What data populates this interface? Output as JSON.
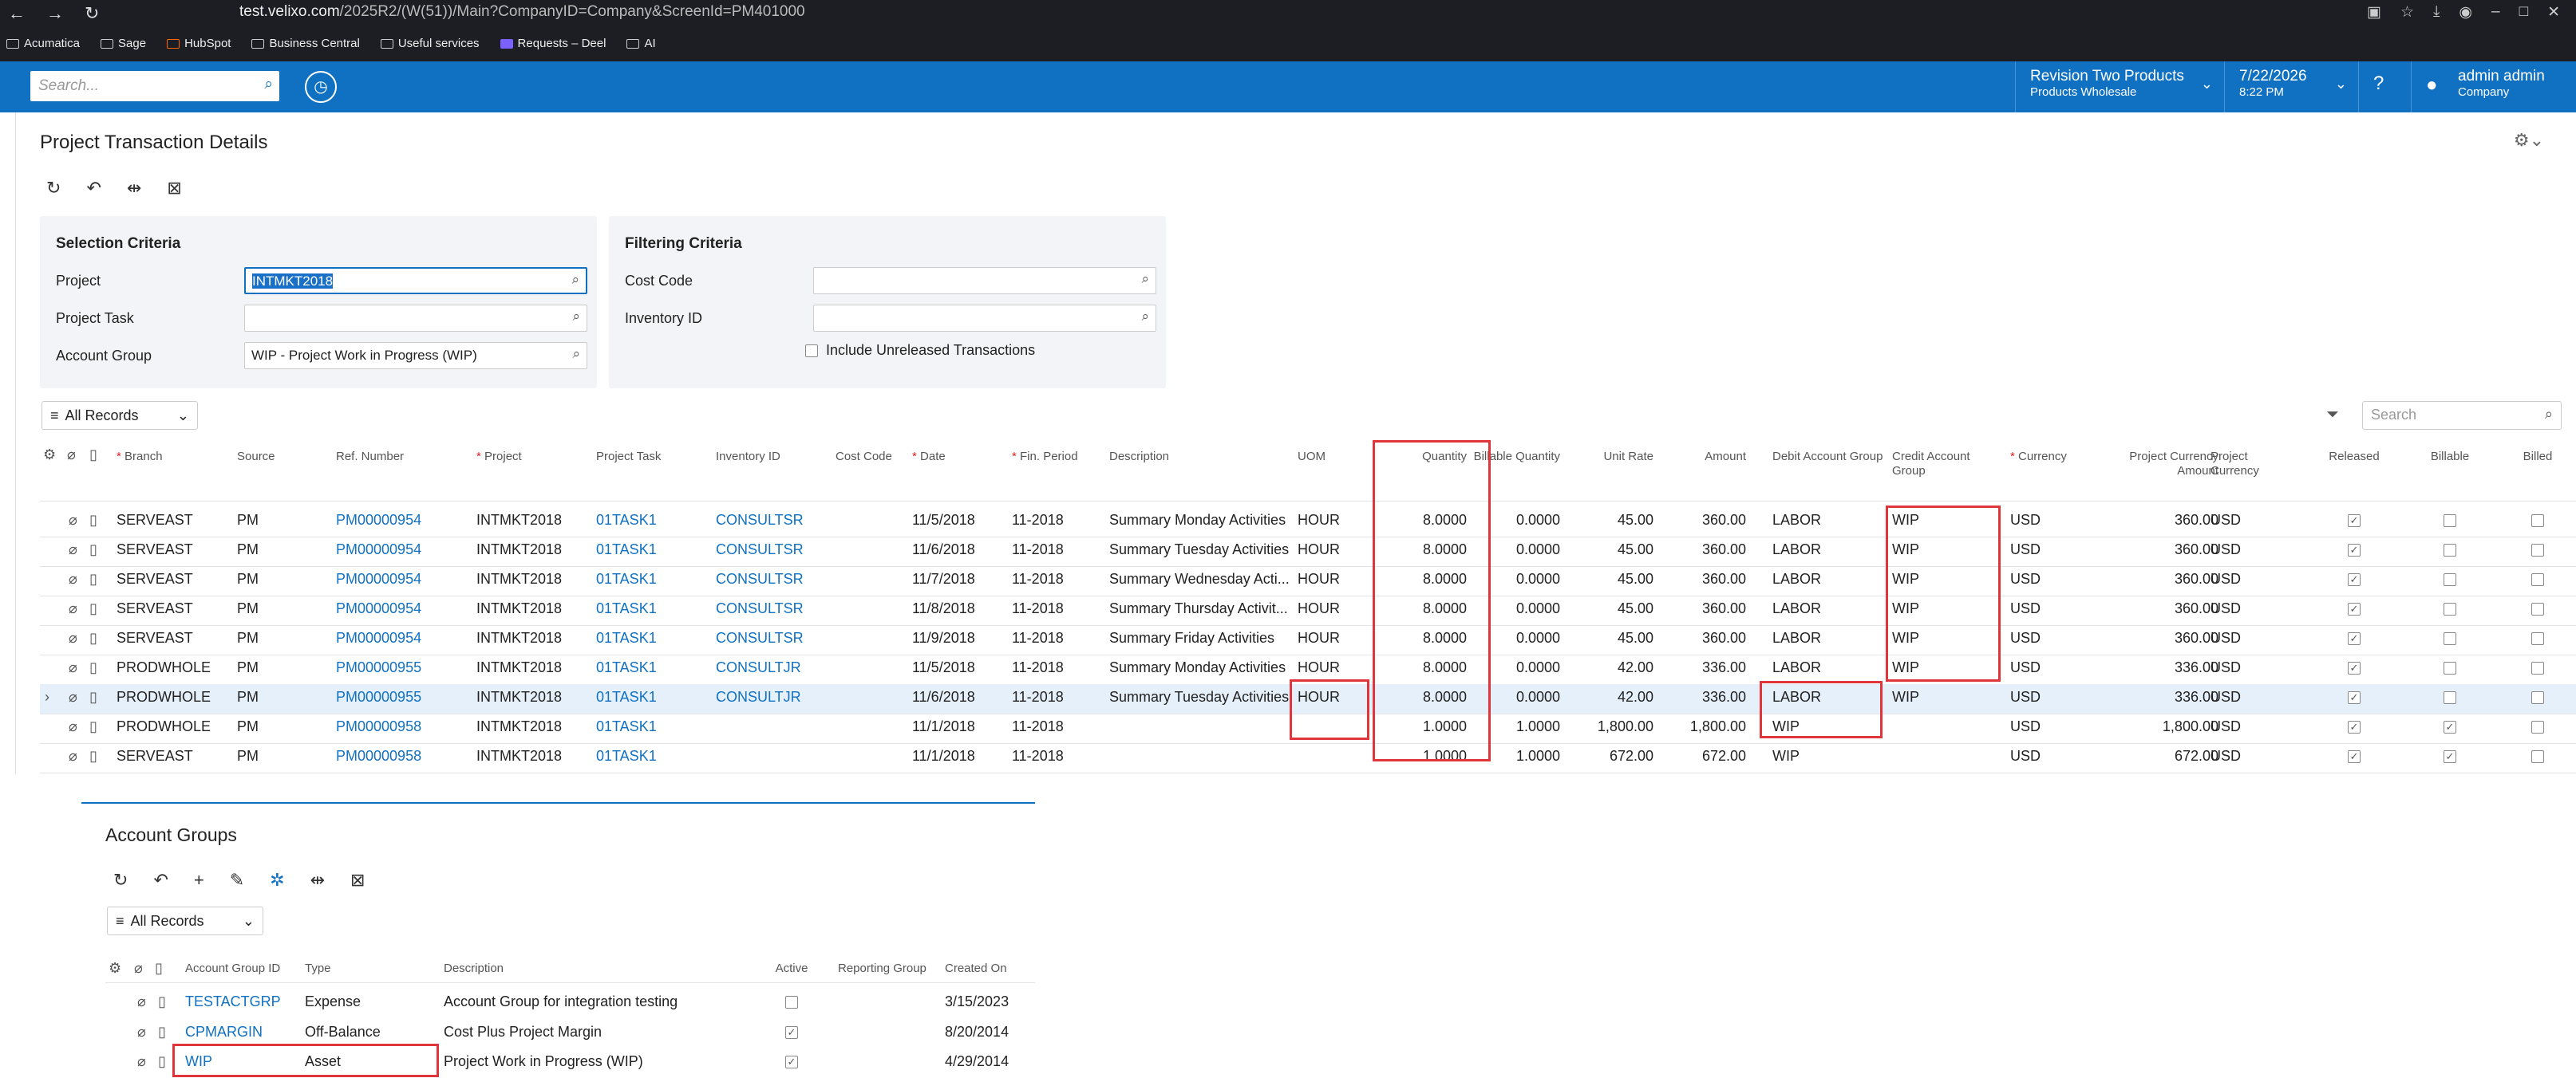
{
  "browser": {
    "url_host": "test.velixo.com",
    "url_path": "/2025R2/(W(51))/Main?CompanyID=Company&ScreenId=PM401000",
    "bookmarks": [
      "Acumatica",
      "Sage",
      "HubSpot",
      "Business Central",
      "Useful services",
      "Requests – Deel",
      "AI"
    ]
  },
  "topbar": {
    "search_placeholder": "Search...",
    "company": "Revision Two Products",
    "branch": "Products Wholesale",
    "date": "7/22/2026",
    "time": "8:22 PM",
    "user": "admin admin",
    "user_company": "Company"
  },
  "page": {
    "title": "Project Transaction Details"
  },
  "selection": {
    "title": "Selection Criteria",
    "project_label": "Project",
    "project_value": "INTMKT2018",
    "task_label": "Project Task",
    "task_value": "",
    "acctgrp_label": "Account Group",
    "acctgrp_value": "WIP - Project Work in Progress (WIP)"
  },
  "filtering": {
    "title": "Filtering Criteria",
    "costcode_label": "Cost Code",
    "inventory_label": "Inventory ID",
    "unreleased_label": "Include Unreleased Transactions"
  },
  "grid": {
    "view": "All Records",
    "search_placeholder": "Search",
    "columns": [
      "Branch",
      "Source",
      "Ref. Number",
      "Project",
      "Project Task",
      "Inventory ID",
      "Cost Code",
      "Date",
      "Fin. Period",
      "Description",
      "UOM",
      "Quantity",
      "Billable Quantity",
      "Unit Rate",
      "Amount",
      "Debit Account Group",
      "Credit Account Group",
      "Currency",
      "Project Currency Amount",
      "Project Currency",
      "Released",
      "Billable",
      "Billed"
    ],
    "rows": [
      {
        "branch": "SERVEAST",
        "source": "PM",
        "ref": "PM00000954",
        "project": "INTMKT2018",
        "task": "01TASK1",
        "inv": "CONSULTSR",
        "date": "11/5/2018",
        "period": "11-2018",
        "desc": "Summary Monday Activities",
        "uom": "HOUR",
        "qty": "8.0000",
        "bqty": "0.0000",
        "rate": "45.00",
        "amount": "360.00",
        "debit": "LABOR",
        "credit": "WIP",
        "cur": "USD",
        "pamt": "360.00",
        "pcur": "USD",
        "released": true,
        "billable": false
      },
      {
        "branch": "SERVEAST",
        "source": "PM",
        "ref": "PM00000954",
        "project": "INTMKT2018",
        "task": "01TASK1",
        "inv": "CONSULTSR",
        "date": "11/6/2018",
        "period": "11-2018",
        "desc": "Summary Tuesday Activities",
        "uom": "HOUR",
        "qty": "8.0000",
        "bqty": "0.0000",
        "rate": "45.00",
        "amount": "360.00",
        "debit": "LABOR",
        "credit": "WIP",
        "cur": "USD",
        "pamt": "360.00",
        "pcur": "USD",
        "released": true,
        "billable": false
      },
      {
        "branch": "SERVEAST",
        "source": "PM",
        "ref": "PM00000954",
        "project": "INTMKT2018",
        "task": "01TASK1",
        "inv": "CONSULTSR",
        "date": "11/7/2018",
        "period": "11-2018",
        "desc": "Summary Wednesday Acti...",
        "uom": "HOUR",
        "qty": "8.0000",
        "bqty": "0.0000",
        "rate": "45.00",
        "amount": "360.00",
        "debit": "LABOR",
        "credit": "WIP",
        "cur": "USD",
        "pamt": "360.00",
        "pcur": "USD",
        "released": true,
        "billable": false
      },
      {
        "branch": "SERVEAST",
        "source": "PM",
        "ref": "PM00000954",
        "project": "INTMKT2018",
        "task": "01TASK1",
        "inv": "CONSULTSR",
        "date": "11/8/2018",
        "period": "11-2018",
        "desc": "Summary Thursday Activit...",
        "uom": "HOUR",
        "qty": "8.0000",
        "bqty": "0.0000",
        "rate": "45.00",
        "amount": "360.00",
        "debit": "LABOR",
        "credit": "WIP",
        "cur": "USD",
        "pamt": "360.00",
        "pcur": "USD",
        "released": true,
        "billable": false
      },
      {
        "branch": "SERVEAST",
        "source": "PM",
        "ref": "PM00000954",
        "project": "INTMKT2018",
        "task": "01TASK1",
        "inv": "CONSULTSR",
        "date": "11/9/2018",
        "period": "11-2018",
        "desc": "Summary Friday Activities",
        "uom": "HOUR",
        "qty": "8.0000",
        "bqty": "0.0000",
        "rate": "45.00",
        "amount": "360.00",
        "debit": "LABOR",
        "credit": "WIP",
        "cur": "USD",
        "pamt": "360.00",
        "pcur": "USD",
        "released": true,
        "billable": false
      },
      {
        "branch": "PRODWHOLE",
        "source": "PM",
        "ref": "PM00000955",
        "project": "INTMKT2018",
        "task": "01TASK1",
        "inv": "CONSULTJR",
        "date": "11/5/2018",
        "period": "11-2018",
        "desc": "Summary Monday Activities",
        "uom": "HOUR",
        "qty": "8.0000",
        "bqty": "0.0000",
        "rate": "42.00",
        "amount": "336.00",
        "debit": "LABOR",
        "credit": "WIP",
        "cur": "USD",
        "pamt": "336.00",
        "pcur": "USD",
        "released": true,
        "billable": false
      },
      {
        "branch": "PRODWHOLE",
        "source": "PM",
        "ref": "PM00000955",
        "project": "INTMKT2018",
        "task": "01TASK1",
        "inv": "CONSULTJR",
        "date": "11/6/2018",
        "period": "11-2018",
        "desc": "Summary Tuesday Activities",
        "uom": "HOUR",
        "qty": "8.0000",
        "bqty": "0.0000",
        "rate": "42.00",
        "amount": "336.00",
        "debit": "LABOR",
        "credit": "WIP",
        "cur": "USD",
        "pamt": "336.00",
        "pcur": "USD",
        "released": true,
        "billable": false
      },
      {
        "branch": "PRODWHOLE",
        "source": "PM",
        "ref": "PM00000958",
        "project": "INTMKT2018",
        "task": "01TASK1",
        "inv": "",
        "date": "11/1/2018",
        "period": "11-2018",
        "desc": "",
        "uom": "",
        "qty": "1.0000",
        "bqty": "1.0000",
        "rate": "1,800.00",
        "amount": "1,800.00",
        "debit": "WIP",
        "credit": "",
        "cur": "USD",
        "pamt": "1,800.00",
        "pcur": "USD",
        "released": true,
        "billable": true
      },
      {
        "branch": "SERVEAST",
        "source": "PM",
        "ref": "PM00000958",
        "project": "INTMKT2018",
        "task": "01TASK1",
        "inv": "",
        "date": "11/1/2018",
        "period": "11-2018",
        "desc": "",
        "uom": "",
        "qty": "1.0000",
        "bqty": "1.0000",
        "rate": "672.00",
        "amount": "672.00",
        "debit": "WIP",
        "credit": "",
        "cur": "USD",
        "pamt": "672.00",
        "pcur": "USD",
        "released": true,
        "billable": true
      }
    ]
  },
  "acct": {
    "title": "Account Groups",
    "view": "All Records",
    "columns": [
      "Account Group ID",
      "Type",
      "Description",
      "Active",
      "Reporting Group",
      "Created On"
    ],
    "rows": [
      {
        "id": "TESTACTGRP",
        "type": "Expense",
        "desc": "Account Group for integration testing",
        "active": false,
        "created": "3/15/2023"
      },
      {
        "id": "CPMARGIN",
        "type": "Off-Balance",
        "desc": "Cost Plus Project Margin",
        "active": true,
        "created": "8/20/2014"
      },
      {
        "id": "WIP",
        "type": "Asset",
        "desc": "Project Work in Progress (WIP)",
        "active": true,
        "created": "4/29/2014"
      }
    ]
  }
}
